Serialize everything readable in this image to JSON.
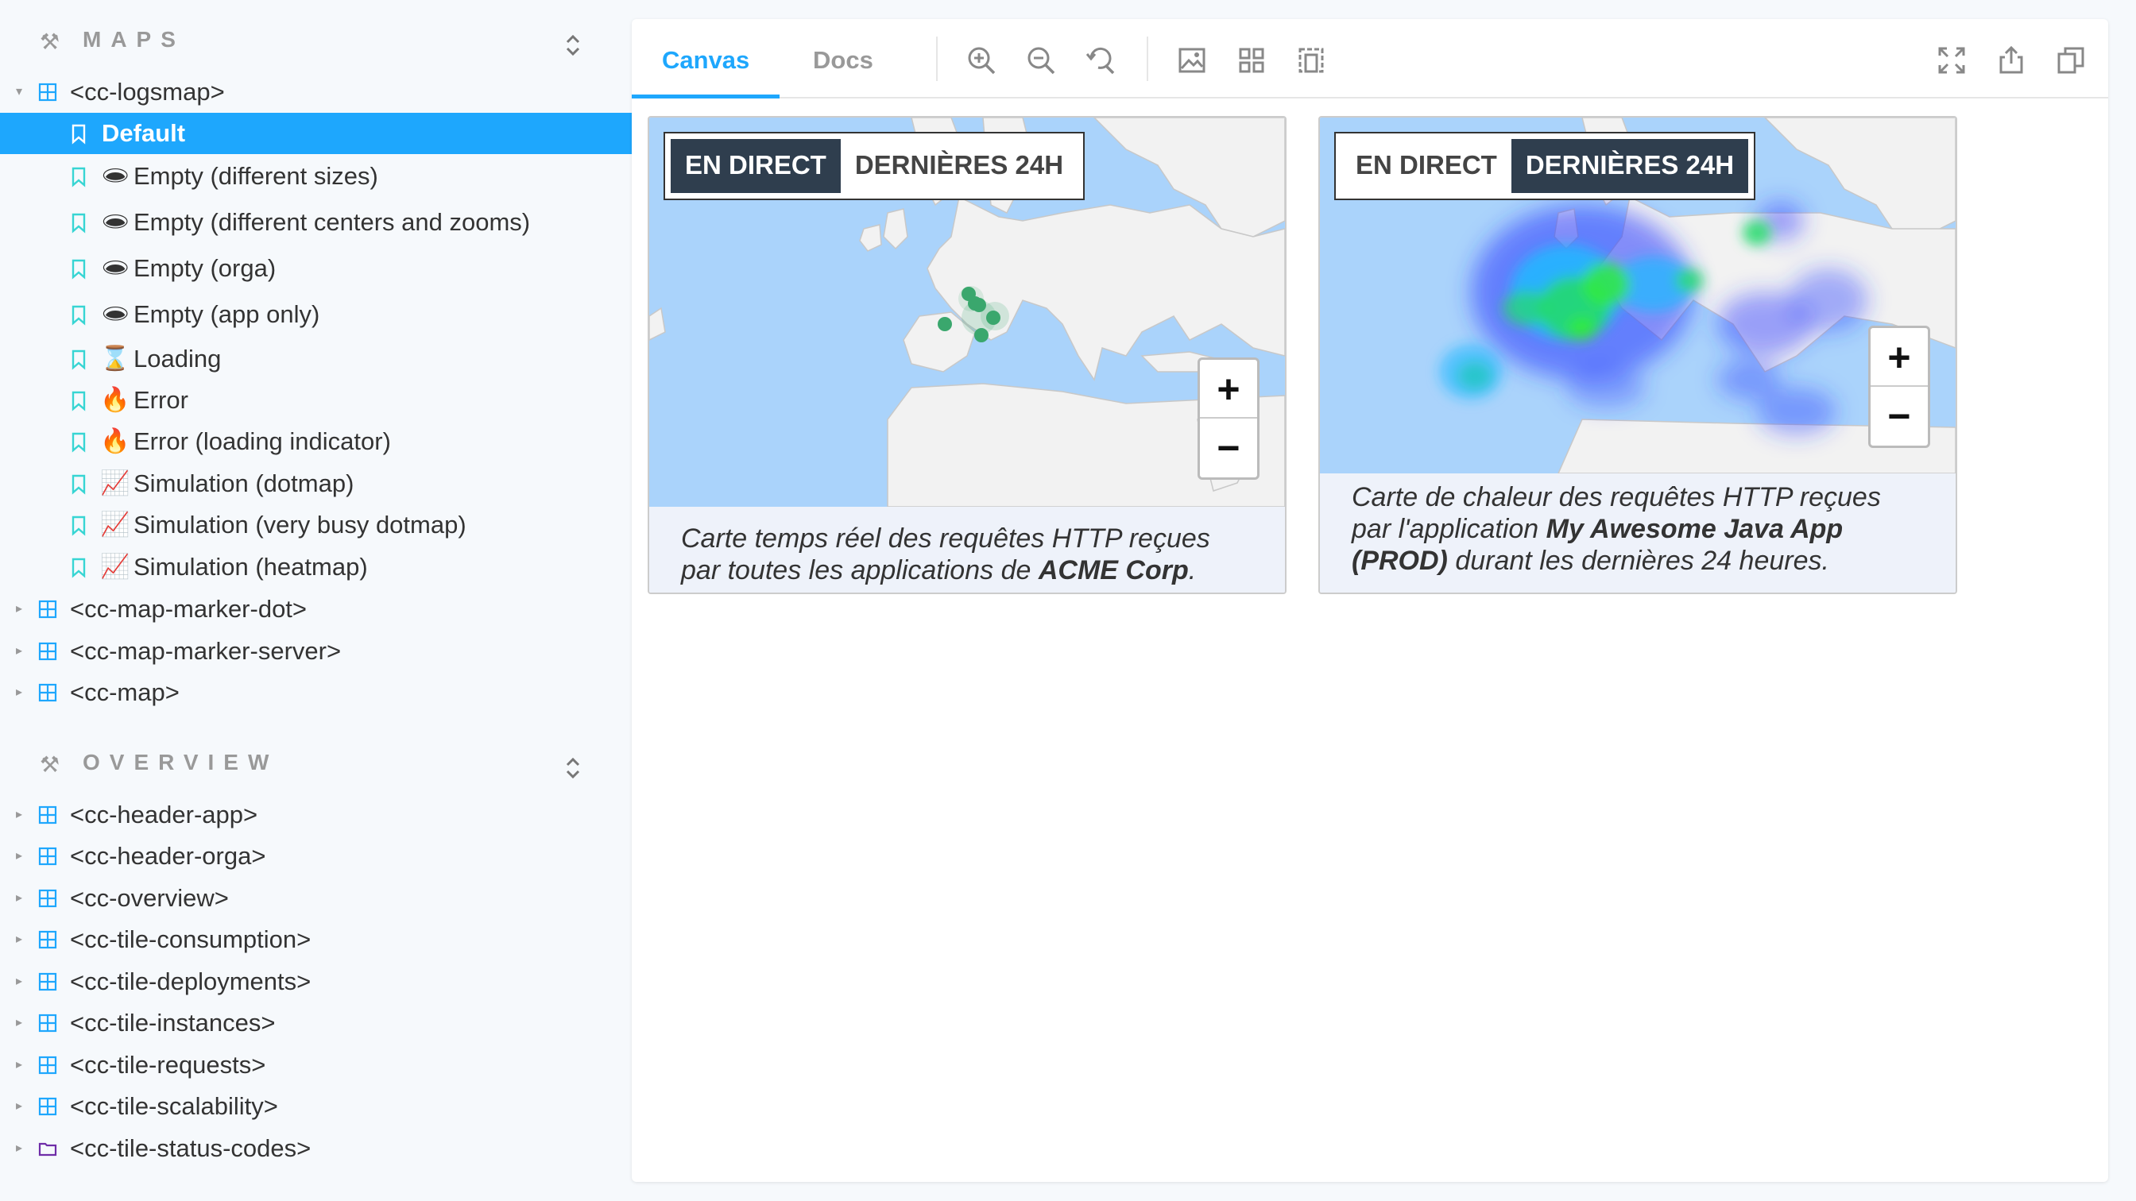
{
  "sidebar": {
    "maps_section": {
      "title": "MAPS"
    },
    "overview_section": {
      "title": "OVERVIEW"
    },
    "logsmap": {
      "label": "<cc-logsmap>",
      "stories": [
        {
          "label": "Default",
          "emoji": ""
        },
        {
          "label": "Empty (different sizes)",
          "emoji": "🕳"
        },
        {
          "label": "Empty (different centers and zooms)",
          "emoji": "🕳"
        },
        {
          "label": "Empty (orga)",
          "emoji": "🕳"
        },
        {
          "label": "Empty (app only)",
          "emoji": "🕳"
        },
        {
          "label": "Loading",
          "emoji": "⌛"
        },
        {
          "label": "Error",
          "emoji": "🔥"
        },
        {
          "label": "Error (loading indicator)",
          "emoji": "🔥"
        },
        {
          "label": "Simulation (dotmap)",
          "emoji": "📈"
        },
        {
          "label": "Simulation (very busy dotmap)",
          "emoji": "📈"
        },
        {
          "label": "Simulation (heatmap)",
          "emoji": "📈"
        }
      ]
    },
    "maps_components": [
      "<cc-map-marker-dot>",
      "<cc-map-marker-server>",
      "<cc-map>"
    ],
    "overview_components": [
      "<cc-header-app>",
      "<cc-header-orga>",
      "<cc-overview>",
      "<cc-tile-consumption>",
      "<cc-tile-deployments>",
      "<cc-tile-instances>",
      "<cc-tile-requests>",
      "<cc-tile-scalability>",
      "<cc-tile-status-codes>"
    ]
  },
  "toolbar": {
    "tabs": {
      "canvas": "Canvas",
      "docs": "Docs"
    },
    "icons": [
      "zoom-in-icon",
      "zoom-out-icon",
      "reset-zoom-icon",
      "background-icon",
      "grid-icon",
      "outline-icon",
      "fullscreen-icon",
      "share-icon",
      "copy-icon"
    ]
  },
  "cards": [
    {
      "mode_live": "EN DIRECT",
      "mode_24h": "DERNIÈRES 24H",
      "active_mode": "live",
      "zoom_in": "+",
      "zoom_out": "−",
      "caption_prefix": "Carte temps réel des requêtes HTTP reçues par toutes les applications de ",
      "caption_bold": "ACME Corp",
      "caption_suffix": "."
    },
    {
      "mode_live": "EN DIRECT",
      "mode_24h": "DERNIÈRES 24H",
      "active_mode": "24h",
      "zoom_in": "+",
      "zoom_out": "−",
      "caption_prefix": "Carte de chaleur des requêtes HTTP reçues par l'application ",
      "caption_bold": "My Awesome Java App (PROD)",
      "caption_suffix": " durant les dernières 24 heures."
    }
  ],
  "colors": {
    "accent": "#1ea7fd",
    "sea": "#aad3fb",
    "land": "#f2f2f2",
    "dot": "#3aa76d",
    "mode_active_bg": "#2f3e4e"
  }
}
